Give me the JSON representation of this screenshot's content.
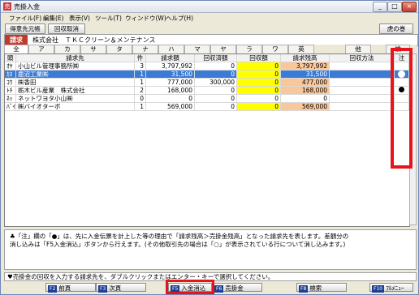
{
  "window": {
    "title": "売掛入金",
    "minimize": "_",
    "maximize": "□",
    "close": "×"
  },
  "menu": [
    "ファイル(F)",
    "編集(E)",
    "表示(V)",
    "ツール(T)",
    "ウィンドウ(W)",
    "ヘルプ(H)"
  ],
  "toolbar": {
    "ledger_btn": "得意先元帳",
    "cancel_btn": "回収取消",
    "scroll_btn": "虎の巻"
  },
  "customer": {
    "label": "請求",
    "name": "株式会社　ＴＫＣクリーン＆メンテナンス"
  },
  "tabs": [
    "全",
    "ア",
    "カ",
    "サ",
    "タ",
    "ナ",
    "ハ",
    "マ",
    "ヤ",
    "ラ",
    "ワ",
    "英",
    "他",
    "検"
  ],
  "columns": [
    "頭",
    "請求先",
    "件",
    "請求額",
    "回収済額",
    "回収額",
    "請求残高",
    "回収方法",
    "注"
  ],
  "rows": [
    {
      "head": "ｵﾔ",
      "name": "小山ビル管理事務所㈱",
      "count": "3",
      "billed": "3,797,992",
      "collected": "0",
      "amount": "0",
      "balance": "3,797,992",
      "method": "",
      "mark": ""
    },
    {
      "head": "ｶﾇ",
      "name": "鹿沼工業㈱",
      "count": "1",
      "billed": "31,500",
      "collected": "0",
      "amount": "0",
      "balance": "31,500",
      "method": "",
      "mark": "○"
    },
    {
      "head": "ｺｳ",
      "name": "㈱香田",
      "count": "1",
      "billed": "777,000",
      "collected": "300,000",
      "amount": "0",
      "balance": "477,000",
      "method": "",
      "mark": ""
    },
    {
      "head": "ﾄﾁ",
      "name": "栃木ビル産業　株式会社",
      "count": "2",
      "billed": "168,000",
      "collected": "0",
      "amount": "0",
      "balance": "168,000",
      "method": "",
      "mark": "●"
    },
    {
      "head": "ﾈｯ",
      "name": "ネットワヨタ小山㈱",
      "count": "0",
      "billed": "0",
      "collected": "0",
      "amount": "0",
      "balance": "0",
      "method": "",
      "mark": ""
    },
    {
      "head": "ﾊﾞｲ",
      "name": "㈱バイオターボ",
      "count": "1",
      "billed": "569,000",
      "collected": "0",
      "amount": "0",
      "balance": "569,000",
      "method": "",
      "mark": ""
    }
  ],
  "notice": {
    "line1": "♣「注」欄の「●」は、先に入金伝票を計上した等の理由で「請求残高＞売掛金残高」となった請求先を表します。差額分の",
    "line2": "消し込みは「F5入金消込」ボタンから行えます。(その他取引先の場合は「○」が表示されている行について消し込みます。)"
  },
  "status": "♥売掛金の回収を入力する請求先を、ダブルクリックまたはエンター・キーで選択してください。",
  "fkeys": [
    {
      "key": "F2",
      "label": "前頁"
    },
    {
      "key": "F3",
      "label": "次頁"
    },
    {
      "key": "F5",
      "label": "入金消込"
    },
    {
      "key": "F6",
      "label": "売掛金"
    },
    {
      "key": "F8",
      "label": "検索"
    },
    {
      "key": "F10",
      "label": "ﾌﾙﾒﾆｭｰ"
    }
  ]
}
